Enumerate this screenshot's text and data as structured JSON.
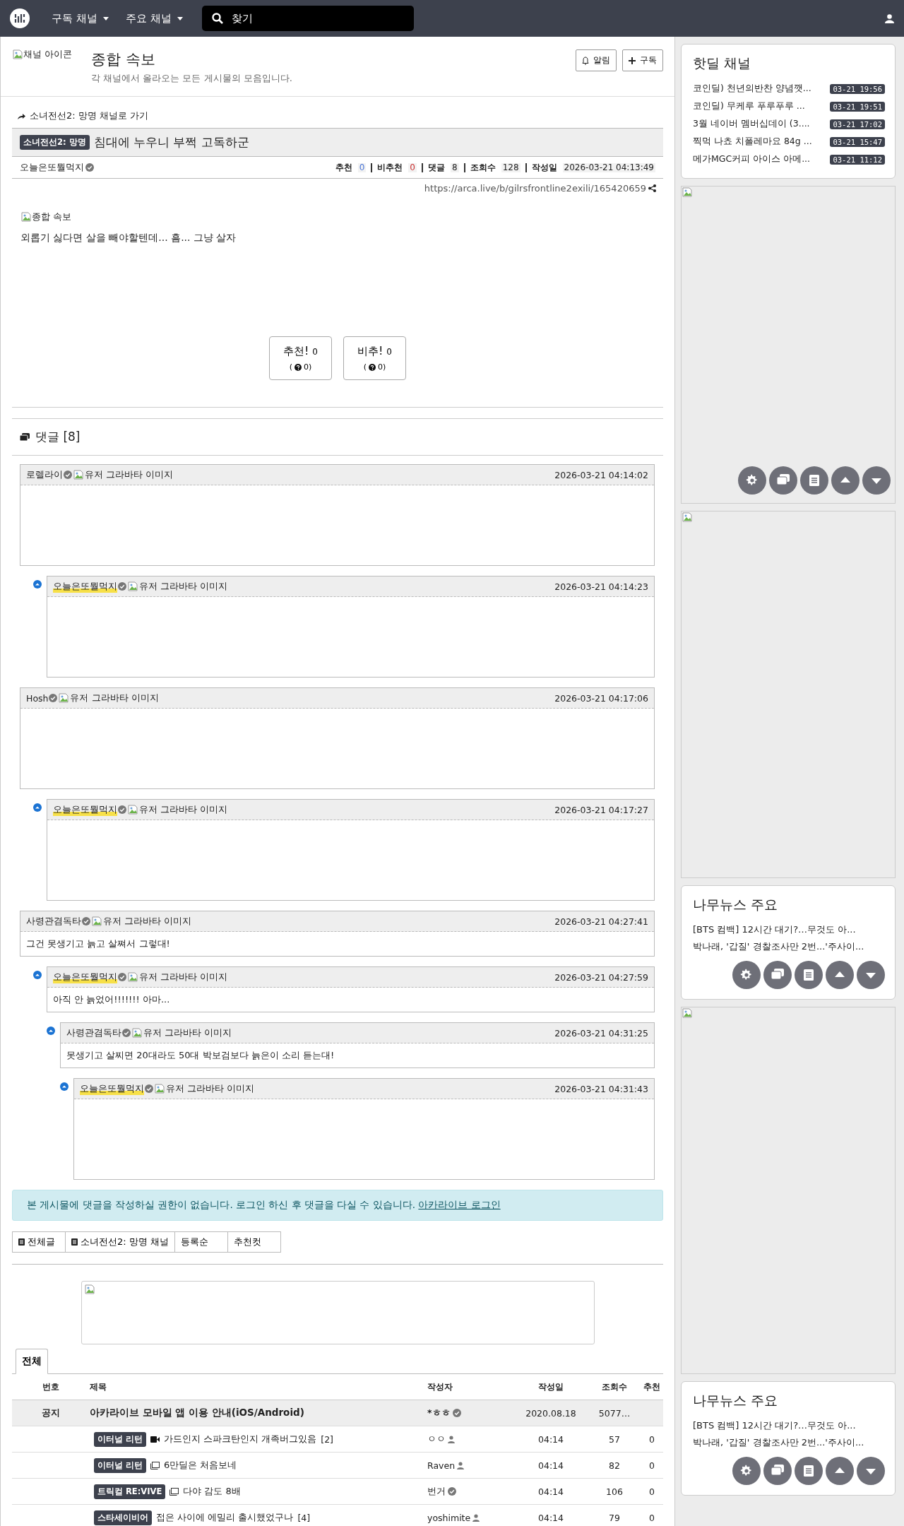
{
  "nav": {
    "menus": [
      {
        "label": "구독 채널"
      },
      {
        "label": "주요 채널"
      }
    ],
    "search": {
      "placeholder": "찾기"
    }
  },
  "channel": {
    "icon_alt": "채널 아이콘",
    "title": "종합 속보",
    "description": "각 채널에서 올라오는 모든 게시물의 모음입니다.",
    "buttons": [
      {
        "kind": "bell",
        "label": "알림"
      },
      {
        "kind": "plus",
        "label": "구독"
      }
    ]
  },
  "article": {
    "channel_link": "소녀전선2: 망명 채널로 가기",
    "badge": "소녀전선2: 망명",
    "title": "침대에 누우니 부쩍 고독하군",
    "author": "오늘은또뭘먹지",
    "author_verified": true,
    "stats": [
      {
        "label": "추천",
        "value": "0",
        "kind": "up"
      },
      {
        "label": "비추천",
        "value": "0",
        "kind": "down"
      },
      {
        "label": "댓글",
        "value": "8",
        "kind": "plain"
      },
      {
        "label": "조회수",
        "value": "128",
        "kind": "plain"
      },
      {
        "label": "작성일",
        "value": "2026-03-21 04:13:49",
        "kind": "plain"
      }
    ],
    "url": "https://arca.live/b/gilrsfrontline2exili/165420659",
    "image_alt": "종합 속보",
    "body": "외롭기 싫다면 살을 빼야할텐데... 흠... 그냥 살자",
    "votes": [
      {
        "label": "추천!",
        "count": "0",
        "sub_prefix": "(",
        "sub": "0)"
      },
      {
        "label": "비추!",
        "count": "0",
        "sub_prefix": "(",
        "sub": "0)"
      }
    ]
  },
  "comments": {
    "title": "댓글 [8]",
    "items": [
      {
        "author": "로렐라이",
        "op": false,
        "time": "2026-03-21 04:14:02",
        "avatar_alt": "유저 그라바타 이미지",
        "kind": "image",
        "children": [
          {
            "author": "오늘은또뭘먹지",
            "op": true,
            "time": "2026-03-21 04:14:23",
            "avatar_alt": "유저 그라바타 이미지",
            "kind": "image"
          }
        ]
      },
      {
        "author": "Hosh",
        "op": false,
        "time": "2026-03-21 04:17:06",
        "avatar_alt": "유저 그라바타 이미지",
        "kind": "image",
        "children": [
          {
            "author": "오늘은또뭘먹지",
            "op": true,
            "time": "2026-03-21 04:17:27",
            "avatar_alt": "유저 그라바타 이미지",
            "kind": "image"
          }
        ]
      },
      {
        "author": "사령관겸독타",
        "op": false,
        "time": "2026-03-21 04:27:41",
        "avatar_alt": "유저 그라바타 이미지",
        "kind": "text",
        "body": "그건 못생기고 늙고 살쪄서 그렇대!",
        "children": [
          {
            "author": "오늘은또뭘먹지",
            "op": true,
            "time": "2026-03-21 04:27:59",
            "avatar_alt": "유저 그라바타 이미지",
            "kind": "text",
            "body": "아직 안 늙었어!!!!!!! 아마...",
            "children": [
              {
                "author": "사령관겸독타",
                "op": false,
                "time": "2026-03-21 04:31:25",
                "avatar_alt": "유저 그라바타 이미지",
                "kind": "text",
                "body": "못생기고 살찌면 20대라도 50대 박보검보다 늙은이 소리 듣는대!",
                "children": [
                  {
                    "author": "오늘은또뭘먹지",
                    "op": true,
                    "time": "2026-03-21 04:31:43",
                    "avatar_alt": "유저 그라바타 이미지",
                    "kind": "image"
                  }
                ]
              }
            ]
          }
        ]
      }
    ]
  },
  "alert": {
    "text": "본 게시물에 댓글을 작성하실 권한이 없습니다. 로그인 하신 후 댓글을 다실 수 있습니다.",
    "link": "아카라이브 로그인"
  },
  "list_tabs": [
    {
      "kind": "board",
      "label": "전체글"
    },
    {
      "kind": "board",
      "label": "소녀전선2: 망명 채널"
    },
    {
      "kind": "plain",
      "label": "등록순"
    },
    {
      "kind": "plain",
      "label": "추천컷"
    }
  ],
  "board": {
    "tabs": [
      {
        "label": "전체",
        "selected": true
      }
    ],
    "columns": [
      "번호",
      "제목",
      "작성자",
      "작성일",
      "조회수",
      "추천"
    ],
    "rows": [
      {
        "kind": "notice",
        "number": "공지",
        "title": "아카라이브 모바일 앱 이용 안내(iOS/Android)",
        "author": {
          "name": "*ㅎㅎ",
          "kind": "verified"
        },
        "date": "2020.08.18",
        "views": "5077…"
      },
      {
        "kind": "post",
        "badge": "이터널 리턴",
        "media": {
          "kind": "video"
        },
        "title": "가드인지 스파크탄인지 개족버그있음",
        "comment_count": "[2]",
        "author": {
          "name": "ㅇㅇ",
          "kind": "user"
        },
        "date": "04:14",
        "views": "57",
        "likes": "0"
      },
      {
        "kind": "post",
        "badge": "이터널 리턴",
        "media": {
          "kind": "image"
        },
        "title": "6만딜은 처음보네",
        "author": {
          "name": "Raven",
          "kind": "user"
        },
        "date": "04:14",
        "views": "82",
        "likes": "0"
      },
      {
        "kind": "post",
        "badge": "트릭컬 RE:VIVE",
        "media": {
          "kind": "image"
        },
        "title": "다야 감도 8배",
        "author": {
          "name": "번거",
          "kind": "verified"
        },
        "date": "04:14",
        "views": "106",
        "likes": "0"
      },
      {
        "kind": "post",
        "badge": "스타세이비어",
        "title": "접은 사이에 에밀리 출시했었구나",
        "comment_count": "[4]",
        "author": {
          "name": "yoshimite",
          "kind": "user"
        },
        "date": "04:14",
        "views": "79",
        "likes": "0"
      }
    ]
  },
  "sidebar": [
    {
      "kind": "hotdeal",
      "title": "핫딜 채널",
      "items": [
        {
          "title": "코인딜) 천년의반찬 양념깻...",
          "time": "03-21 19:56"
        },
        {
          "title": "코인딜) 무케루 푸루푸루 ...",
          "time": "03-21 19:51"
        },
        {
          "title": "3월 네이버 멤버십데이 (3....",
          "time": "03-21 17:02"
        },
        {
          "title": "찍먹 나쵸 치폴레마요 84g ...",
          "time": "03-21 15:47"
        },
        {
          "title": "메가MGC커피 아이스 아메...",
          "time": "03-21 11:12"
        }
      ]
    },
    {
      "kind": "ad",
      "toolbar": true
    },
    {
      "kind": "ad"
    },
    {
      "kind": "news",
      "title": "나무뉴스 주요",
      "toolbar": true,
      "items": [
        "[BTS 컴백] 12시간 대기?…무것도 아...",
        "박나래, '갑질' 경찰조사만 2번...'주사이..."
      ]
    },
    {
      "kind": "ad"
    },
    {
      "kind": "news",
      "title": "나무뉴스 주요",
      "toolbar": true,
      "items": [
        "[BTS 컴백] 12시간 대기?…무것도 아...",
        "박나래, '갑질' 경찰조사만 2번...'주사이..."
      ]
    }
  ]
}
